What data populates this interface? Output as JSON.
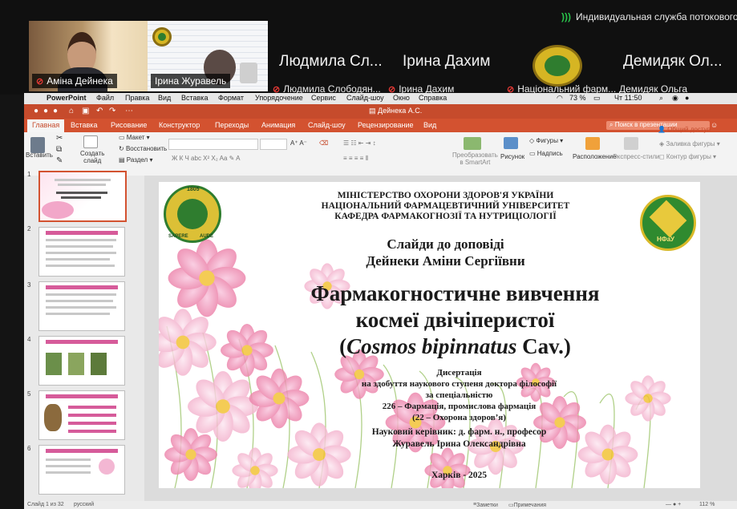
{
  "call": {
    "cast_status": "Индивидуальная служба потокового в",
    "participants": [
      {
        "name": "Аміна Дейнека"
      },
      {
        "name": "Ірина Журавель"
      },
      {
        "big_name": "Людмила Сл...",
        "name": "Людмила Слободян..."
      },
      {
        "big_name": "Ірина Дахим",
        "name": "Ірина Дахим"
      },
      {
        "name": "Національний фарм..."
      },
      {
        "big_name": "Демидяк Ол...",
        "name": "Демидяк Ольга"
      }
    ]
  },
  "menubar": {
    "items": [
      "PowerPoint",
      "Файл",
      "Правка",
      "Вид",
      "Вставка",
      "Формат",
      "Упорядочение",
      "Сервис",
      "Слайд-шоу",
      "Окно",
      "Справка"
    ],
    "battery": "73 %",
    "clock": "Чт 11:50"
  },
  "window": {
    "title": "Дейнека А.С.",
    "tabs": [
      "Главная",
      "Вставка",
      "Рисование",
      "Конструктор",
      "Переходы",
      "Анимация",
      "Слайд-шоу",
      "Рецензирование",
      "Вид"
    ],
    "active_tab": "Главная",
    "search_placeholder": "Поиск в презентации",
    "share_label": "Общий доступ"
  },
  "ribbon": {
    "paste": "Вставить",
    "new_slide": "Создать\nслайд",
    "layout": "Макет",
    "reset": "Восстановить",
    "section": "Раздел",
    "convert_smartart": "Преобразовать\nв SmartArt",
    "picture": "Рисунок",
    "shapes": "Фигуры",
    "textbox": "Надпись",
    "arrange": "Расположение",
    "quick_styles": "Экспресс-стили",
    "shape_fill": "Заливка фигуры",
    "shape_outline": "Контур фигуры"
  },
  "slide": {
    "ministry": "МІНІСТЕРСТВО ОХОРОНИ ЗДОРОВ'Я УКРАЇНИ",
    "university": "НАЦІОНАЛЬНИЙ ФАРМАЦЕВТИЧНИЙ УНІВЕРСИТЕТ",
    "department": "КАФЕДРА ФАРМАКОГНОЗІЇ ТА НУТРИЦІОЛОГІЇ",
    "slides_for": "Слайди до доповіді",
    "author": "Дейнеки Аміни Сергіївни",
    "title_line1": "Фармакогностичне вивчення",
    "title_line2": "космеї двічіперистої",
    "title_paren_open": "(",
    "title_latin": "Cosmos bipinnatus",
    "title_auth": " Cav.)",
    "dissertation": "Дисертація",
    "degree": "на здобуття наукового ступеня доктора філософії",
    "specialty_label": "за спеціальністю",
    "specialty": "226 – Фармація, промислова фармація",
    "field": "(22 – Охорона здоров’я)",
    "supervisor_label": "Науковий керівник: д. фарм. н., професор",
    "supervisor": "Журавель Ірина Олександрівна",
    "city_year": "Харків - 2025",
    "emblem_year": "1805",
    "emblem_motto_left": "SAPERE",
    "emblem_motto_right": "AUDE",
    "badge_text": "НФаУ"
  },
  "thumbs": {
    "numbers": [
      "1",
      "2",
      "3",
      "4",
      "5",
      "6"
    ]
  },
  "statusbar": {
    "slide_counter": "Слайд 1 из 32",
    "language": "русский",
    "notes": "Заметки",
    "comments": "Примечания",
    "zoom": "112 %"
  }
}
